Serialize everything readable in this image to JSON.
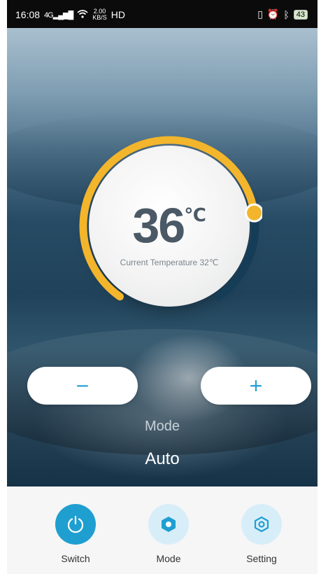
{
  "status_bar": {
    "time": "16:08",
    "signal": "4G",
    "net_speed_value": "2.00",
    "net_speed_unit": "KB/S",
    "hd": "HD",
    "battery": "43"
  },
  "thermostat": {
    "set_temp": "36",
    "unit": "℃",
    "current_label": "Current Temperature 32℃",
    "arc_level": 0.78
  },
  "controls": {
    "minus": "−",
    "plus": "+"
  },
  "mode": {
    "label": "Mode",
    "value": "Auto"
  },
  "tabs": [
    {
      "label": "Switch",
      "icon": "power-icon"
    },
    {
      "label": "Mode",
      "icon": "hexagon-icon"
    },
    {
      "label": "Setting",
      "icon": "settings-hexagon-icon"
    }
  ],
  "colors": {
    "accent_blue": "#1f9fd0",
    "arc_yellow": "#f2b52c",
    "track_dark": "#163d58"
  }
}
